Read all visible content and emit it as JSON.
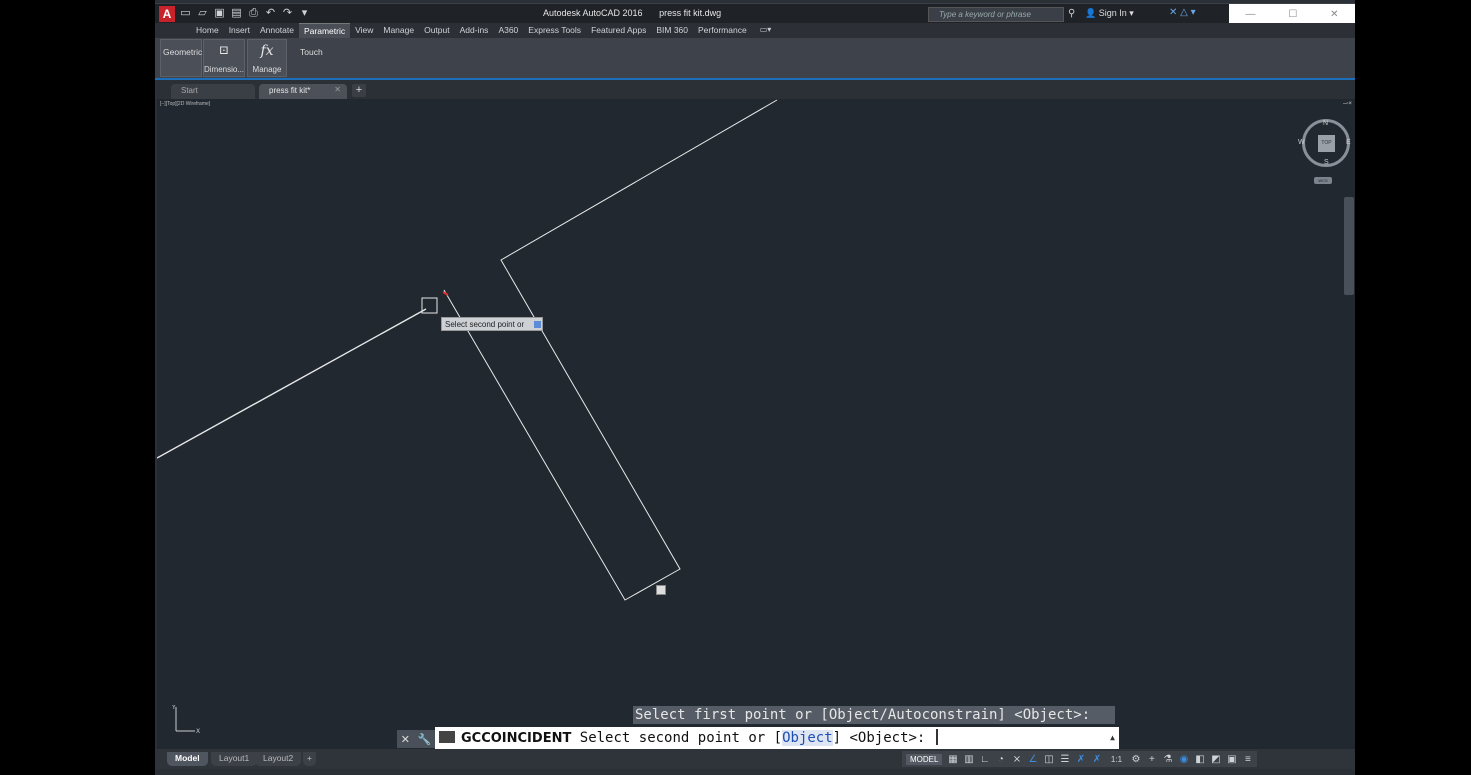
{
  "app": {
    "title": "Autodesk AutoCAD 2016",
    "document": "press fit kit.dwg"
  },
  "search": {
    "placeholder": "Type a keyword or phrase"
  },
  "account": {
    "signin_label": "Sign In"
  },
  "menu": {
    "tabs": [
      "Home",
      "Insert",
      "Annotate",
      "Parametric",
      "View",
      "Manage",
      "Output",
      "Add-ins",
      "A360",
      "Express Tools",
      "Featured Apps",
      "BIM 360",
      "Performance"
    ],
    "active": "Parametric"
  },
  "ribbon": {
    "geometric_label": "Geometric",
    "dimensional_label": "Dimensio...",
    "manage_label": "Manage",
    "touch_label": "Touch",
    "fx_symbol": "fx"
  },
  "file_tabs": {
    "start_label": "Start",
    "doc_label": "press fit kit*"
  },
  "viewport": {
    "label": "[−][Top][2D Wireframe]",
    "viewcube": {
      "top": "TOP",
      "n": "N",
      "s": "S",
      "e": "E",
      "w": "W",
      "wcs": "WCS"
    }
  },
  "tooltip": {
    "text": "Select second point or"
  },
  "command": {
    "history": "Select first point or [Object/Autoconstrain] <Object>:",
    "name": "GCCOINCIDENT",
    "prompt_before": "Select second point or [",
    "option": "Object",
    "prompt_after": "] <Object>:"
  },
  "layout_tabs": [
    "Model",
    "Layout1",
    "Layout2"
  ],
  "status": {
    "model_label": "MODEL",
    "scale_label": "1:1"
  },
  "colors": {
    "canvas": "#212830",
    "accent": "#1c6fb8",
    "error_marker": "#e03030"
  }
}
